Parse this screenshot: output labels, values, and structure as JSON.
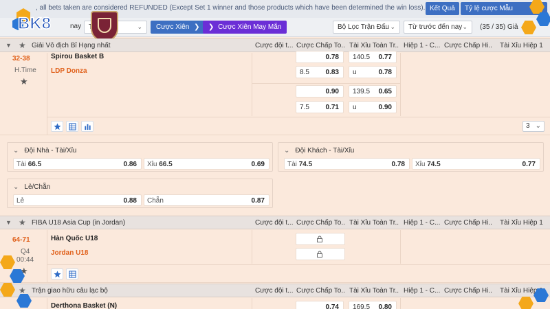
{
  "notice": {
    "text": ", all bets taken are considered REFUNDED (Except Set 1 winner and those products which have been determined the win loss).",
    "results_button": "Kết Quả",
    "odds_button": "Tỷ lệ cược Mẫu"
  },
  "logo": {
    "brand": "BK8"
  },
  "filters": {
    "sport_select": "T",
    "sport_prefix": "nay",
    "parlay_button": "Cược Xiên",
    "lucky_parlay_button": "Cược Xiên May Mắn",
    "match_filter": "Bộ Lọc Trận Đấu",
    "time_filter": "Từ trước đến nay",
    "count": "(35 / 35) Giả"
  },
  "columns": {
    "c1": "Cược đội t...",
    "c2": "Cược Chấp To...",
    "c3": "Tài Xỉu Toàn Tr...",
    "c4": "Hiệp 1 - C...",
    "c5": "Cược Chấp Hi...",
    "c6": "Tài Xỉu Hiệp 1"
  },
  "leagues": [
    {
      "name": "Giải Vô địch Bỉ Hạng nhất",
      "match": {
        "score": "32-38",
        "period": "H.Time",
        "home": "Spirou Basket B",
        "away": "LDP Donza",
        "handicap": [
          {
            "line": "",
            "price": "0.78"
          },
          {
            "line": "8.5",
            "price": "0.83"
          },
          {
            "line": "",
            "price": "0.90"
          },
          {
            "line": "7.5",
            "price": "0.71"
          }
        ],
        "totals": [
          {
            "line": "140.5",
            "price": "0.77"
          },
          {
            "line": "u",
            "price": "0.78"
          },
          {
            "line": "139.5",
            "price": "0.65"
          },
          {
            "line": "u",
            "price": "0.90"
          }
        ],
        "more_count": "3"
      },
      "extra": {
        "home_ou": {
          "title": "Đội Nhà - Tài/Xỉu",
          "over_label": "Tài",
          "over_line": "66.5",
          "over_price": "0.86",
          "under_label": "Xỉu",
          "under_line": "66.5",
          "under_price": "0.69"
        },
        "away_ou": {
          "title": "Đội Khách - Tài/Xỉu",
          "over_label": "Tài",
          "over_line": "74.5",
          "over_price": "0.78",
          "under_label": "Xỉu",
          "under_line": "74.5",
          "under_price": "0.77"
        },
        "odd_even": {
          "title": "Lẻ/Chẵn",
          "odd_label": "Lẻ",
          "odd_price": "0.88",
          "even_label": "Chẵn",
          "even_price": "0.87"
        }
      }
    },
    {
      "name": "FIBA U18 Asia Cup (in Jordan)",
      "match": {
        "score": "64-71",
        "period": "Q4",
        "clock": "00:44",
        "home": "Hàn Quốc U18",
        "away": "Jordan U18"
      }
    },
    {
      "name": "Trận giao hữu câu lạc bộ",
      "match": {
        "home": "Derthona Basket (N)",
        "handicap_price": "0.74",
        "total_line": "169.5",
        "total_price": "0.80"
      }
    }
  ],
  "colors": {
    "accent_orange": "#e0601a",
    "primary_blue": "#3d6fc2",
    "lucky_purple": "#6b2ed6",
    "row_bg": "#fbe9dc"
  }
}
